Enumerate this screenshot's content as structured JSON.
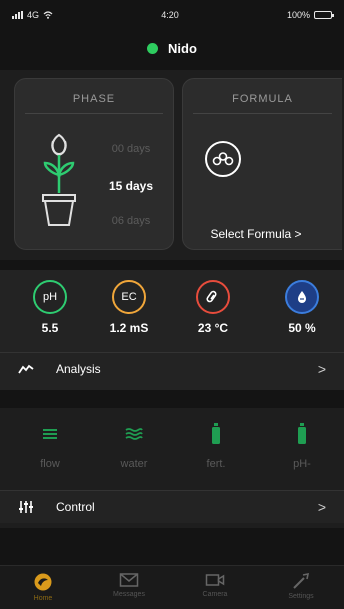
{
  "status_bar": {
    "carrier": "4G",
    "time": "4:20",
    "battery": "100%"
  },
  "device": {
    "name": "Nido",
    "status_color": "#2ecc5f"
  },
  "phase_card": {
    "title": "PHASE",
    "days_prev": "00 days",
    "days_current": "15 days",
    "days_next": "06 days",
    "plant_icon": "plant-pot-icon"
  },
  "formula_card": {
    "title": "FORMULA",
    "icon": "molecule-icon",
    "select_label": "Select Formula >"
  },
  "sensors": [
    {
      "name": "pH",
      "icon": "ph-icon",
      "value": "5.5",
      "color": "#2ecc71"
    },
    {
      "name": "EC",
      "icon": "ec-icon",
      "value": "1.2 mS",
      "color": "#f0a63a"
    },
    {
      "name": "temperature",
      "icon": "thermometer-icon",
      "value": "23 °C",
      "color": "#e74c3c"
    },
    {
      "name": "humidity",
      "icon": "humidity-icon",
      "value": "50 %",
      "color": "#3b7ddd"
    }
  ],
  "analysis_row": {
    "label": "Analysis",
    "icon": "chart-line-icon",
    "chevron": ">"
  },
  "devices": [
    {
      "label": "flow",
      "icon": "flow-icon"
    },
    {
      "label": "water",
      "icon": "water-icon"
    },
    {
      "label": "fert.",
      "icon": "fertilizer-icon"
    },
    {
      "label": "pH-",
      "icon": "ph-minus-icon"
    }
  ],
  "control_row": {
    "label": "Control",
    "icon": "sliders-icon",
    "chevron": ">"
  },
  "tab_bar": [
    {
      "label": "Home",
      "icon": "home-icon",
      "active": true
    },
    {
      "label": "Messages",
      "icon": "mail-icon",
      "active": false
    },
    {
      "label": "Camera",
      "icon": "camera-icon",
      "active": false
    },
    {
      "label": "Settings",
      "icon": "tools-icon",
      "active": false
    }
  ],
  "colors": {
    "accent_green": "#2ecc71",
    "device_green": "#1f9e52",
    "active_tab": "#d99a1c",
    "background": "#141414",
    "card": "#2c2c2c"
  }
}
